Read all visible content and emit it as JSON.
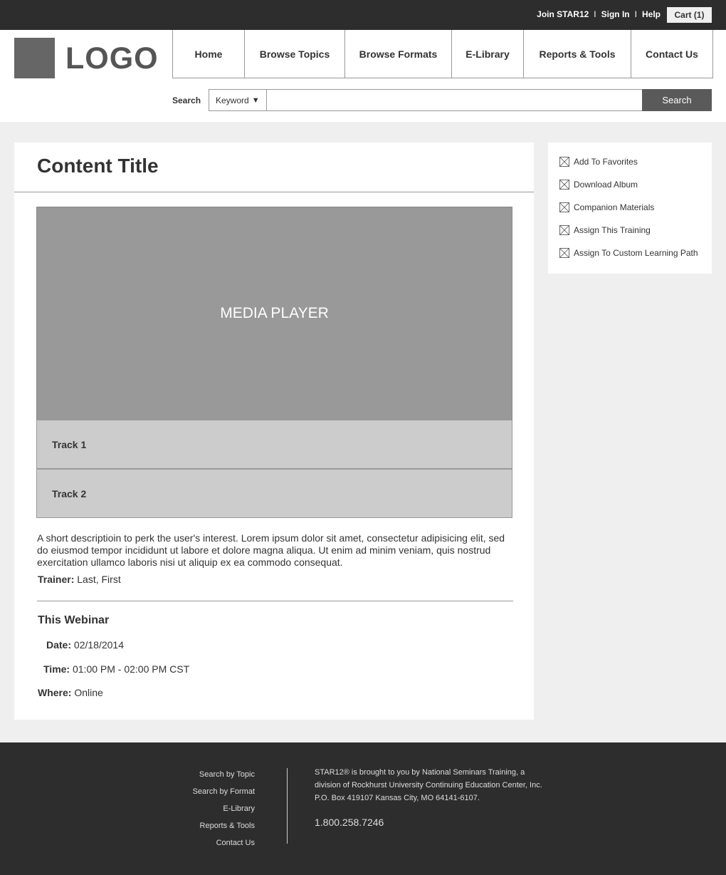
{
  "topbar": {
    "links": [
      "Join STAR12",
      "Sign In",
      "Help"
    ],
    "separator": "I",
    "cart": "Cart (1)"
  },
  "header": {
    "logo": "LOGO",
    "nav": [
      "Home",
      "Browse Topics",
      "Browse Formats",
      "E-Library",
      "Reports & Tools",
      "Contact Us"
    ],
    "search": {
      "label": "Search",
      "type_selected": "Keyword",
      "placeholder": "",
      "value": "",
      "button": "Search"
    }
  },
  "main": {
    "title": "Content Title",
    "player_label": "MEDIA PLAYER",
    "tracks": [
      "Track 1",
      "Track 2"
    ],
    "description": "A short descriptioin to perk the user's interest. Lorem ipsum dolor sit amet, consectetur adipisicing elit, sed do eiusmod tempor incididunt ut labore et dolore magna aliqua. Ut enim ad minim veniam, quis nostrud exercitation ullamco laboris nisi ut aliquip ex ea commodo consequat.",
    "trainer_label": "Trainer:",
    "trainer_value": "Last, First",
    "webinar": {
      "heading": "This Webinar",
      "date_label": "Date:",
      "date_value": "02/18/2014",
      "time_label": "Time:",
      "time_value": "01:00 PM - 02:00 PM CST",
      "where_label": "Where:",
      "where_value": "Online"
    }
  },
  "sidebar": {
    "actions": [
      "Add To Favorites",
      "Download Album",
      "Companion Materials",
      "Assign This Training",
      "Assign To Custom Learning Path"
    ]
  },
  "footer": {
    "links": [
      "Search by Topic",
      "Search by Format",
      "E-Library",
      "Reports & Tools",
      "Contact Us"
    ],
    "about": "STAR12® is brought to you by National Seminars Training, a division of Rockhurst University Continuing Education Center, Inc. P.O. Box 419107 Kansas City, MO 64141-6107.",
    "phone": "1.800.258.7246"
  },
  "colors": {
    "topbar": "#2d2d2d",
    "page_bg": "#efefef",
    "player": "#999999",
    "track": "#cccccc",
    "search_button": "#5a5a5a"
  }
}
